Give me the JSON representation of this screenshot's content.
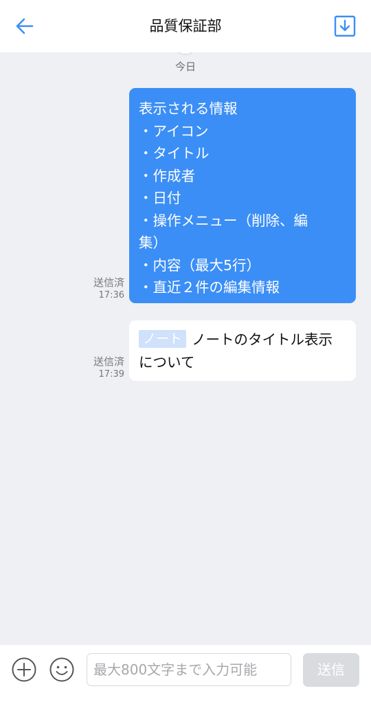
{
  "header": {
    "title": "品質保証部",
    "back_icon": "arrow-left-icon",
    "download_icon": "download-icon"
  },
  "chat": {
    "day_label": "今日",
    "messages": [
      {
        "lines": [
          "表示される情報",
          "・アイコン",
          "・タイトル",
          "・作成者",
          "・日付",
          "・操作メニュー（削除、編",
          "集）",
          "・内容（最大5行）",
          "・直近２件の編集情報"
        ],
        "status": "送信済",
        "time": "17:36"
      },
      {
        "tag": "ノート",
        "text": "ノートのタイトル表示について",
        "status": "送信済",
        "time": "17:39"
      }
    ]
  },
  "footer": {
    "plus_icon": "plus-circle-icon",
    "emoji_icon": "emoji-icon",
    "input_placeholder": "最大800文字まで入力可能",
    "input_value": "",
    "send_label": "送信"
  },
  "colors": {
    "accent": "#3b8ef6",
    "background": "#eef0f4",
    "send_disabled": "#d9dbde"
  }
}
